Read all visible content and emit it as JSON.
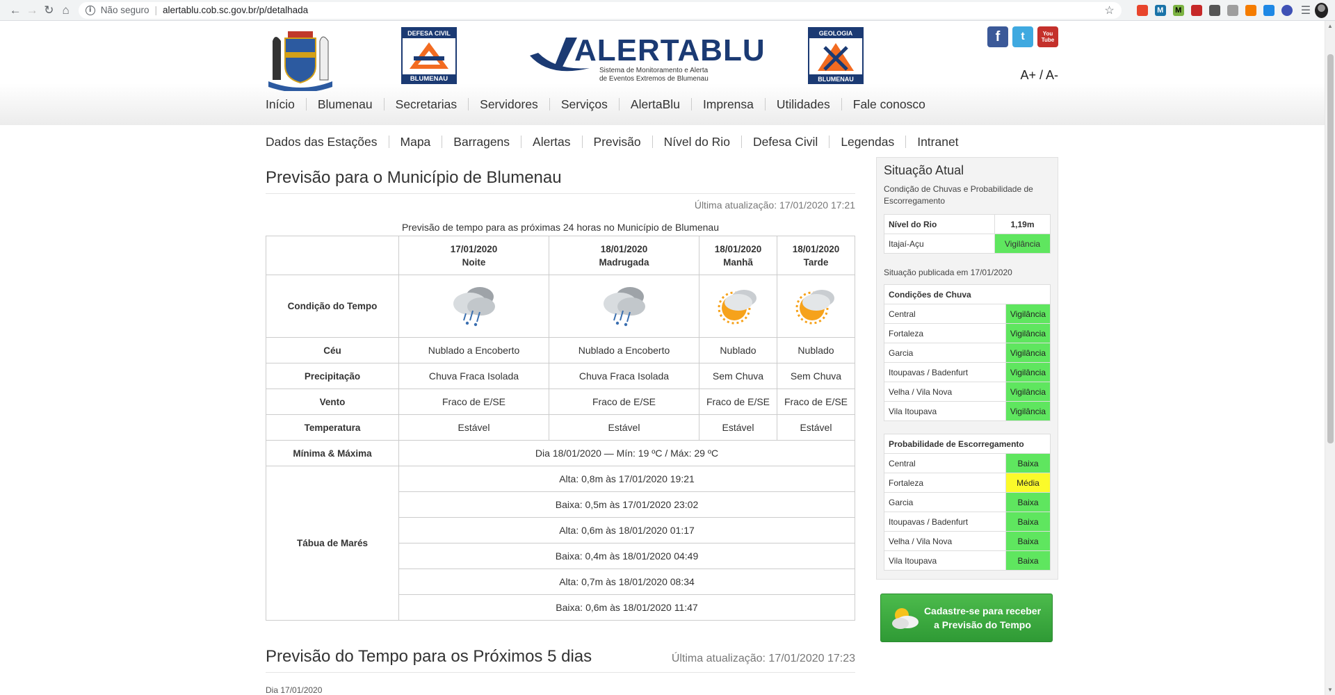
{
  "browser": {
    "security_label": "Não seguro",
    "url": "alertablu.cob.sc.gov.br/p/detalhada"
  },
  "header": {
    "defesa_civil_top": "DEFESA CIVIL",
    "defesa_civil_bottom": "BLUMENAU",
    "alerta_brand": "ALERTABLU",
    "alerta_subtitle_1": "Sistema de Monitoramento e Alerta",
    "alerta_subtitle_2": "de Eventos Extremos de Blumenau",
    "geologia_top": "GEOLOGIA",
    "geologia_bottom": "BLUMENAU",
    "font_size_label": "A+ / A-",
    "youtube_label_1": "You",
    "youtube_label_2": "Tube"
  },
  "main_nav": [
    "Início",
    "Blumenau",
    "Secretarias",
    "Servidores",
    "Serviços",
    "AlertaBlu",
    "Imprensa",
    "Utilidades",
    "Fale conosco"
  ],
  "sub_nav": [
    "Dados das Estações",
    "Mapa",
    "Barragens",
    "Alertas",
    "Previsão",
    "Nível do Rio",
    "Defesa Civil",
    "Legendas",
    "Intranet"
  ],
  "forecast": {
    "title": "Previsão para o Município de Blumenau",
    "updated": "Última atualização: 17/01/2020 17:21",
    "caption": "Previsão de tempo para as próximas 24 horas no Município de Blumenau",
    "periods": [
      {
        "date": "17/01/2020",
        "period": "Noite",
        "icon": "rain-cloud-icon",
        "ceu": "Nublado a Encoberto",
        "precip": "Chuva Fraca Isolada",
        "vento": "Fraco de E/SE",
        "temp": "Estável"
      },
      {
        "date": "18/01/2020",
        "period": "Madrugada",
        "icon": "rain-cloud-icon",
        "ceu": "Nublado a Encoberto",
        "precip": "Chuva Fraca Isolada",
        "vento": "Fraco de E/SE",
        "temp": "Estável"
      },
      {
        "date": "18/01/2020",
        "period": "Manhã",
        "icon": "sun-cloud-icon",
        "ceu": "Nublado",
        "precip": "Sem Chuva",
        "vento": "Fraco de E/SE",
        "temp": "Estável"
      },
      {
        "date": "18/01/2020",
        "period": "Tarde",
        "icon": "sun-cloud-icon",
        "ceu": "Nublado",
        "precip": "Sem Chuva",
        "vento": "Fraco de E/SE",
        "temp": "Estável"
      }
    ],
    "rows": {
      "condicao": "Condição do Tempo",
      "ceu": "Céu",
      "precip": "Precipitação",
      "vento": "Vento",
      "temp": "Temperatura",
      "minmax": "Mínima & Máxima",
      "mares": "Tábua de Marés"
    },
    "minmax_value": "Dia 18/01/2020 — Mín: 19 ºC / Máx: 29 ºC",
    "tides": [
      "Alta: 0,8m às 17/01/2020 19:21",
      "Baixa: 0,5m às 17/01/2020 23:02",
      "Alta: 0,6m às 18/01/2020 01:17",
      "Baixa: 0,4m às 18/01/2020 04:49",
      "Alta: 0,7m às 18/01/2020 08:34",
      "Baixa: 0,6m às 18/01/2020 11:47"
    ]
  },
  "forecast5": {
    "title": "Previsão do Tempo para os Próximos 5 dias",
    "updated": "Última atualização: 17/01/2020 17:23",
    "cutoff_text": "Dia 17/01/2020"
  },
  "sidebar": {
    "title": "Situação Atual",
    "subtitle": "Condição de Chuvas e Probabilidade de Escorregamento",
    "river_header": "Nível do Rio",
    "river_value": "1,19m",
    "river_name": "Itajaí-Açu",
    "river_status": "Vigilância",
    "published": "Situação publicada em 17/01/2020",
    "rain_header": "Condições de Chuva",
    "rain": [
      {
        "name": "Central",
        "status": "Vigilância",
        "color": "#5fe65f"
      },
      {
        "name": "Fortaleza",
        "status": "Vigilância",
        "color": "#5fe65f"
      },
      {
        "name": "Garcia",
        "status": "Vigilância",
        "color": "#5fe65f"
      },
      {
        "name": "Itoupavas / Badenfurt",
        "status": "Vigilância",
        "color": "#5fe65f"
      },
      {
        "name": "Velha / Vila Nova",
        "status": "Vigilância",
        "color": "#5fe65f"
      },
      {
        "name": "Vila Itoupava",
        "status": "Vigilância",
        "color": "#5fe65f"
      }
    ],
    "slide_header": "Probabilidade de Escorregamento",
    "slide": [
      {
        "name": "Central",
        "status": "Baixa",
        "color": "#5fe65f"
      },
      {
        "name": "Fortaleza",
        "status": "Média",
        "color": "#fbfa2a"
      },
      {
        "name": "Garcia",
        "status": "Baixa",
        "color": "#5fe65f"
      },
      {
        "name": "Itoupavas / Badenfurt",
        "status": "Baixa",
        "color": "#5fe65f"
      },
      {
        "name": "Velha / Vila Nova",
        "status": "Baixa",
        "color": "#5fe65f"
      },
      {
        "name": "Vila Itoupava",
        "status": "Baixa",
        "color": "#5fe65f"
      }
    ],
    "cta_line1": "Cadastre-se para receber",
    "cta_line2": "a Previsão do Tempo"
  }
}
